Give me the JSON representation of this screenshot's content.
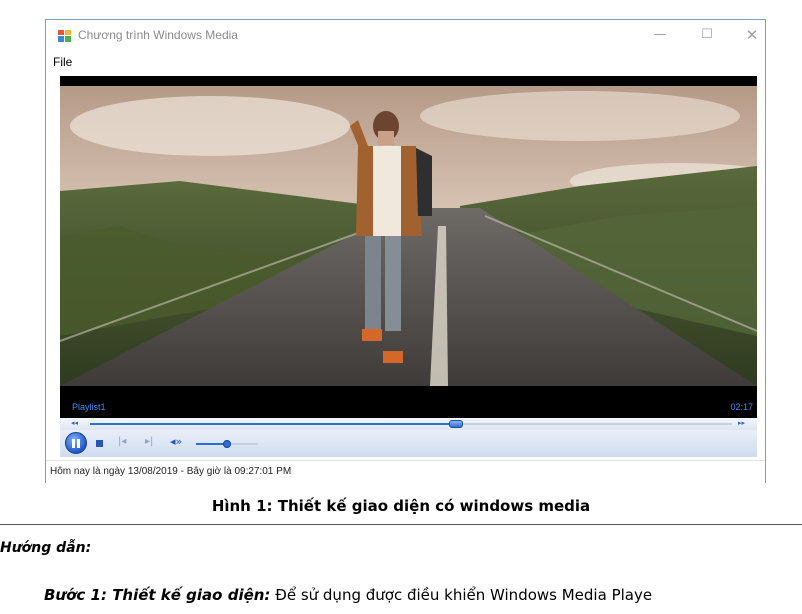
{
  "window": {
    "title": "Chương trình Windows Media",
    "controls": {
      "minimize": "—",
      "maximize": "☐",
      "close": "✕"
    }
  },
  "menu": {
    "items": [
      "File"
    ]
  },
  "player": {
    "playlist_label": "Playlist1",
    "current_time": "02:17",
    "seek_progress": 0.57,
    "volume_level": 0.5,
    "buttons": {
      "rewind": "◂◂",
      "fast_forward": "▸▸",
      "prev": "|◂",
      "next": "▸|",
      "volume": "◂»"
    }
  },
  "statusbar": {
    "text": "Hôm nay là ngày 13/08/2019 - Bây giờ là 09:27:01 PM"
  },
  "document": {
    "caption": "Hình 1: Thiết kế giao diện có windows media",
    "guide_heading": "Hướng dẫn:",
    "step1_label": "Bước 1: Thiết kế giao diện:",
    "step1_text": " Để sử dụng được điều khiển Windows Media Playe"
  },
  "colors": {
    "accent": "#2f6fd1",
    "hud_text": "#3f8cf5",
    "window_border": "#7a9ccf"
  }
}
